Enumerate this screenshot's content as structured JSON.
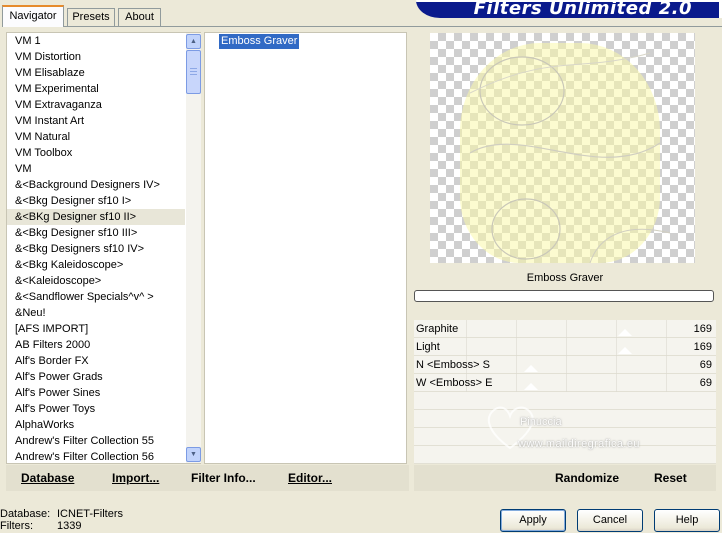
{
  "tabs": [
    {
      "label": "Navigator"
    },
    {
      "label": "Presets"
    },
    {
      "label": "About"
    }
  ],
  "app_title": "Filters Unlimited 2.0",
  "filter_categories": [
    {
      "label": "VM 1"
    },
    {
      "label": "VM Distortion"
    },
    {
      "label": "VM Elisablaze"
    },
    {
      "label": "VM Experimental"
    },
    {
      "label": "VM Extravaganza"
    },
    {
      "label": "VM Instant Art"
    },
    {
      "label": "VM Natural"
    },
    {
      "label": "VM Toolbox"
    },
    {
      "label": "VM"
    },
    {
      "label": "&<Background Designers IV>"
    },
    {
      "label": "&<Bkg Designer sf10 I>"
    },
    {
      "label": "&<BKg Designer sf10 II>"
    },
    {
      "label": "&<Bkg Designer sf10 III>"
    },
    {
      "label": "&<Bkg Designers sf10 IV>"
    },
    {
      "label": "&<Bkg Kaleidoscope>"
    },
    {
      "label": "&<Kaleidoscope>"
    },
    {
      "label": "&<Sandflower Specials^v^ >"
    },
    {
      "label": "&Neu!"
    },
    {
      "label": "[AFS IMPORT]"
    },
    {
      "label": "AB Filters 2000"
    },
    {
      "label": "Alf's Border FX"
    },
    {
      "label": "Alf's Power Grads"
    },
    {
      "label": "Alf's Power Sines"
    },
    {
      "label": "Alf's Power Toys"
    },
    {
      "label": "AlphaWorks"
    },
    {
      "label": "Andrew's Filter Collection 55"
    },
    {
      "label": "Andrew's Filter Collection 56"
    }
  ],
  "selected_category_index": 11,
  "effects": [
    {
      "label": "Emboss Graver"
    }
  ],
  "selected_filter_name": "Emboss Graver",
  "parameters": [
    {
      "label": "Graphite",
      "value": "169",
      "level": 169
    },
    {
      "label": "Light",
      "value": "169",
      "level": 169
    },
    {
      "label": "N <Emboss> S",
      "value": "69",
      "level": 69
    },
    {
      "label": "W <Emboss> E",
      "value": "69",
      "level": 69
    }
  ],
  "left_toolbar": {
    "database": "Database",
    "import": "Import...",
    "filter_info": "Filter Info...",
    "editor": "Editor..."
  },
  "right_toolbar": {
    "randomize": "Randomize",
    "reset": "Reset"
  },
  "status": {
    "database_label": "Database:",
    "database_value": "ICNET-Filters",
    "filters_label": "Filters:",
    "filters_value": "1339"
  },
  "dialog_buttons": {
    "apply": "Apply",
    "cancel": "Cancel",
    "help": "Help"
  },
  "watermark": {
    "name": "Pinuccia",
    "url": "www.maildiregrafica.eu"
  }
}
